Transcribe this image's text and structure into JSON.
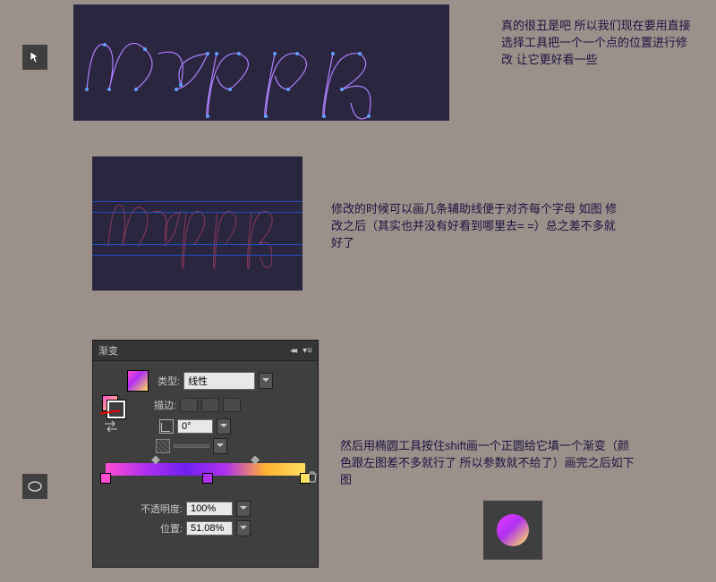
{
  "section1": {
    "script_text": "happy",
    "desc": "真的很丑是吧 所以我们现在要用直接选择工具把一个一个点的位置进行修改 让它更好看一些",
    "tool_icon": "direct-select-arrow"
  },
  "section2": {
    "script_text": "happy",
    "desc": "修改的时候可以画几条辅助线便于对齐每个字母 如图 修改之后（其实也并没有好看到哪里去= =）总之差不多就好了"
  },
  "section3": {
    "tool_icon": "ellipse",
    "desc": "然后用椭圆工具按住shift画一个正圆给它填一个渐变（颜色跟左图差不多就行了 所以参数就不给了）画完之后如下图",
    "panel": {
      "title": "渐变",
      "type_label": "类型:",
      "type_value": "线性",
      "stroke_label": "描边:",
      "angle_label": "△",
      "angle_value": "0°",
      "aspect_icon": "aspect",
      "opacity_label": "不透明度:",
      "opacity_value": "100%",
      "position_label": "位置:",
      "position_value": "51.08%",
      "gradient_stops": [
        {
          "pos": 0,
          "color": "#ff4dd2"
        },
        {
          "pos": 51,
          "color": "#b030f0"
        },
        {
          "pos": 100,
          "color": "#ffe060"
        }
      ]
    }
  }
}
